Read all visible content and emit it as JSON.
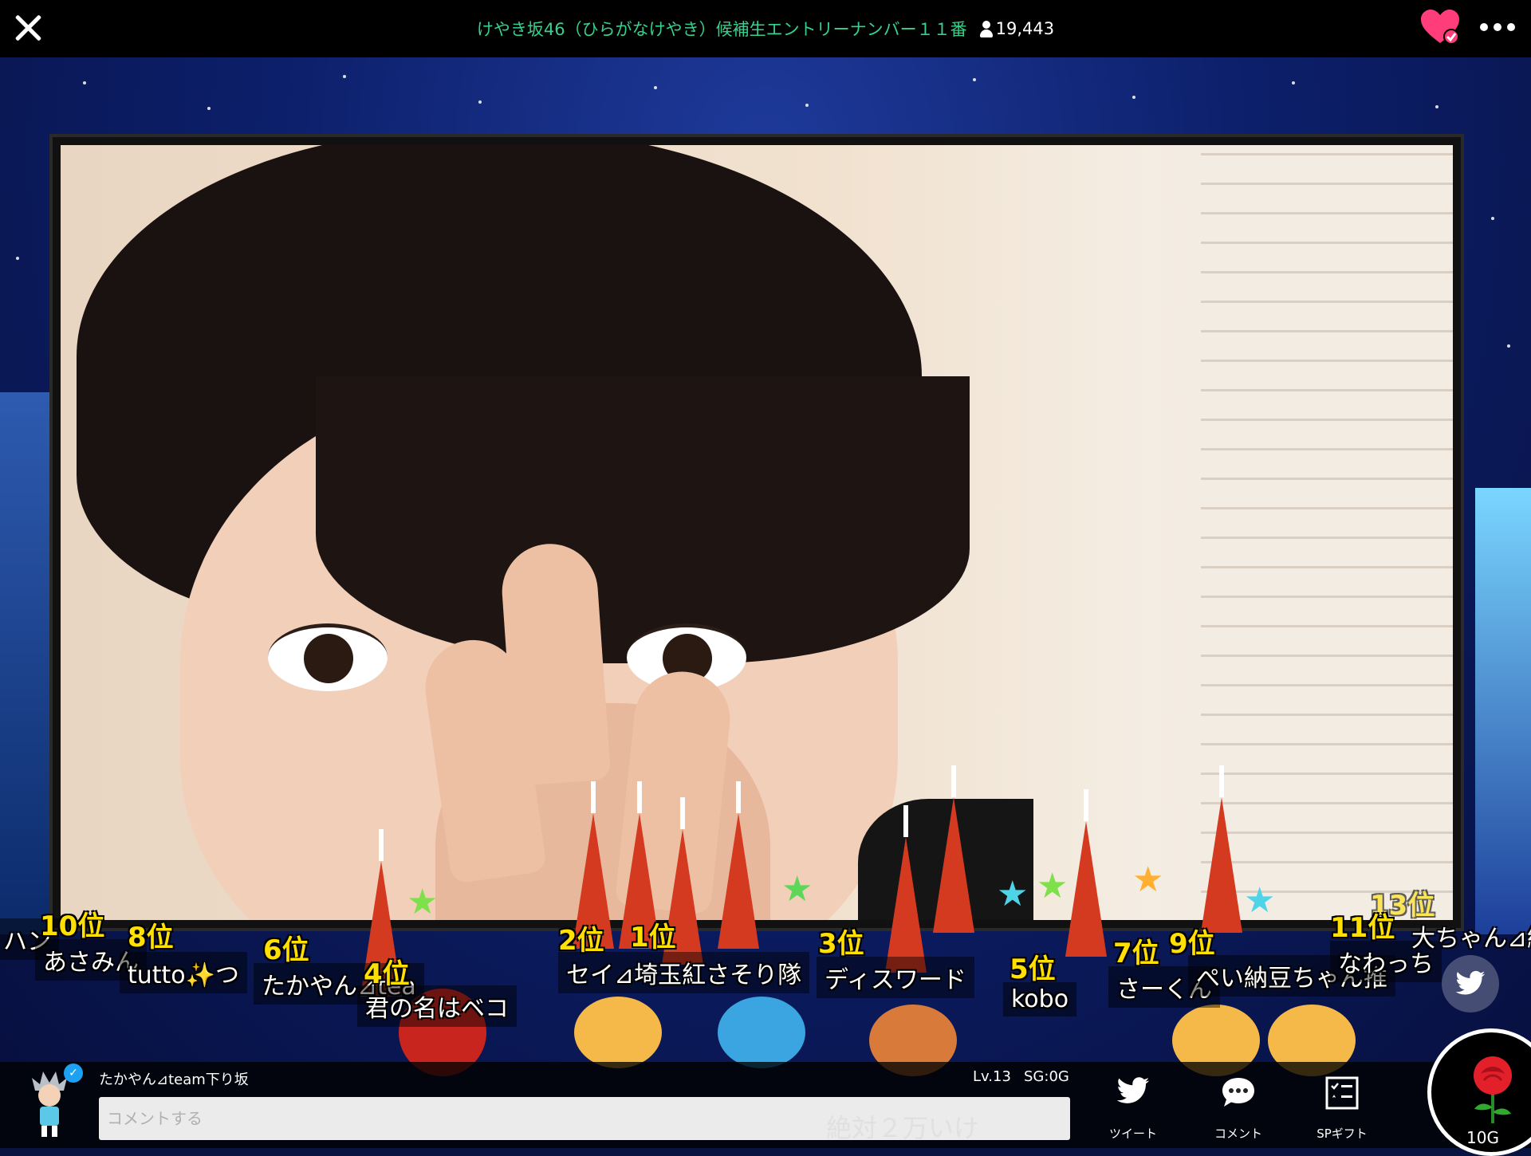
{
  "header": {
    "title": "けやき坂46（ひらがなけやき）候補生エントリーナンバー１１番",
    "viewer_count": "19,443"
  },
  "ranking": [
    {
      "rank": "13位",
      "name": ""
    },
    {
      "rank": "10位",
      "name": "あさみん"
    },
    {
      "rank": "8位",
      "name": "tutto✨つ"
    },
    {
      "rank": "6位",
      "name": "たかやん⊿tea"
    },
    {
      "rank": "4位",
      "name": "君の名はベコ"
    },
    {
      "rank": "2位",
      "name": "セイ⊿埼玉紅さそり隊"
    },
    {
      "rank": "1位",
      "name": ""
    },
    {
      "rank": "3位",
      "name": "ディスワード"
    },
    {
      "rank": "5位",
      "name": "kobo"
    },
    {
      "rank": "7位",
      "name": "さーくん"
    },
    {
      "rank": "9位",
      "name": "ぺい納豆ちゃん推"
    },
    {
      "rank": "11位",
      "name": "なわっち"
    },
    {
      "rank": "13位",
      "name": "大ちゃん⊿納豆"
    }
  ],
  "left_edge_text": "ハン",
  "user": {
    "name": "たかやん⊿team下り坂",
    "level": "Lv.13",
    "sg": "SG:0G"
  },
  "comment": {
    "placeholder": "コメントする",
    "ghost_text": "絶対２万いけ"
  },
  "actions": {
    "tweet": "ツイート",
    "comment": "コメント",
    "sp_gift": "SPギフト"
  },
  "gift": {
    "price": "10G"
  },
  "colors": {
    "title": "#38d08c",
    "heart": "#ff3d7a",
    "rank_text": "#ffe000"
  }
}
